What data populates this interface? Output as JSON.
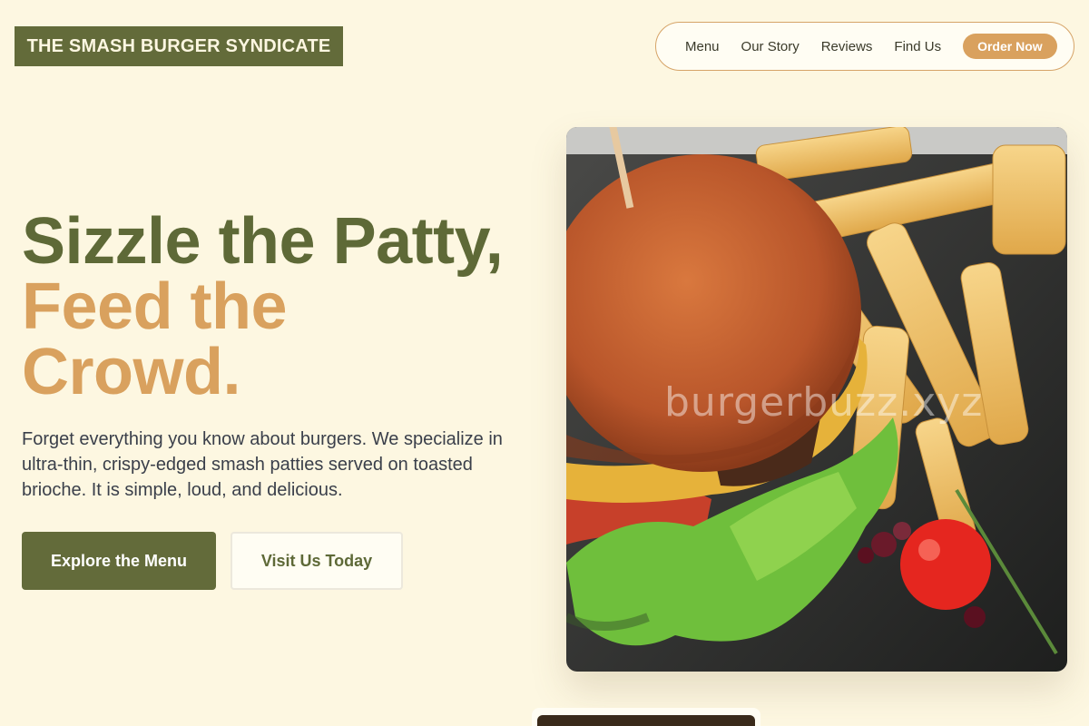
{
  "brand": {
    "name": "THE SMASH BURGER SYNDICATE"
  },
  "nav": {
    "items": [
      "Menu",
      "Our Story",
      "Reviews",
      "Find Us"
    ],
    "cta": "Order Now"
  },
  "hero": {
    "headline_line1": "Sizzle the Patty,",
    "headline_line2": "Feed the",
    "headline_line3": "Crowd.",
    "lede": "Forget everything you know about burgers. We specialize in ultra-thin, crispy-edged smash patties served on toasted brioche. It is simple, loud, and delicious.",
    "primary_button": "Explore the Menu",
    "secondary_button": "Visit Us Today",
    "image_watermark": "burgerbuzz.xyz"
  },
  "colors": {
    "background": "#fdf7e1",
    "olive": "#636b3a",
    "tan": "#d9a15e"
  }
}
